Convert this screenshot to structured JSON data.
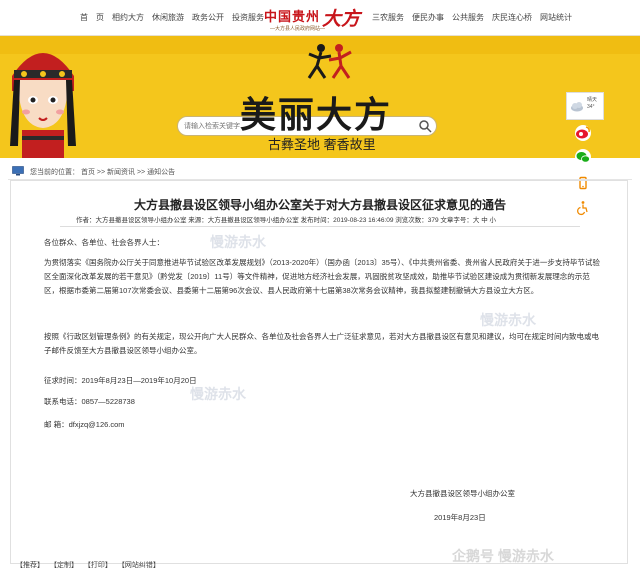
{
  "nav": {
    "left": [
      "首",
      "页",
      "相约大方",
      "休闲旅游",
      "政务公开",
      "投资服务"
    ],
    "right": [
      "三农服务",
      "便民办事",
      "公共服务",
      "庆民连心桥",
      "网站统计"
    ]
  },
  "logo": {
    "main": "中国贵州",
    "script": "大方",
    "sub": "—大方县人民政府网站—"
  },
  "banner": {
    "search_placeholder": "请输入检索关键字",
    "title": "美丽大方",
    "subtitle": "古彝圣地   奢香故里"
  },
  "weather": {
    "line1": "晴天",
    "line2": "34°"
  },
  "breadcrumb": {
    "label": "您当前的位置：",
    "path": "首页 >> 新闻资讯 >> 通知公告"
  },
  "article": {
    "title": "大方县撤县设区领导小组办公室关于对大方县撤县设区征求意见的通告",
    "meta": "作者：大方县撤县设区领导小组办公室  来源：大方县撤县设区领导小组办公室  发布时间：2019-08-23 16:46:09  浏览次数：379  文章字号：大  中  小",
    "greeting": "各位群众、各单位、社会各界人士：",
    "p1": "为贯彻落实《国务院办公厅关于同意推进毕节试验区改革发展规划》（2013-2020年）（国办函〔2013〕35号）、《中共贵州省委、贵州省人民政府关于进一步支持毕节试验区全面深化改革发展的若干意见》（黔党发〔2019〕11号）等文件精神，促进地方经济社会发展，巩固脱贫攻坚成效，助推毕节试验区建设成为贯彻新发展理念的示范区，根据市委第二届第107次常委会议、县委第十二届第96次会议、县人民政府第十七届第38次常务会议精神，我县拟整建制撤销大方县设立大方区。",
    "p2": "按照《行政区划管理条例》的有关规定，现公开向广大人民群众、各单位及社会各界人士广泛征求意见，若对大方县撤县设区有意见和建议，均可在规定时间内致电或电子邮件反馈至大方县撤县设区领导小组办公室。",
    "time": "征求时间：2019年8月23日—2019年10月20日",
    "phone": "联系电话：0857—5228738",
    "email": "邮    箱：dfxjzq@126.com",
    "sign_org": "大方县撤县设区领导小组办公室",
    "sign_date": "2019年8月23日"
  },
  "watermarks": {
    "text": "慢游赤水",
    "corner": "企鹅号 慢游赤水"
  },
  "footer": [
    "【推荐】",
    "【定制】",
    "【打印】",
    "【网站纠错】"
  ]
}
